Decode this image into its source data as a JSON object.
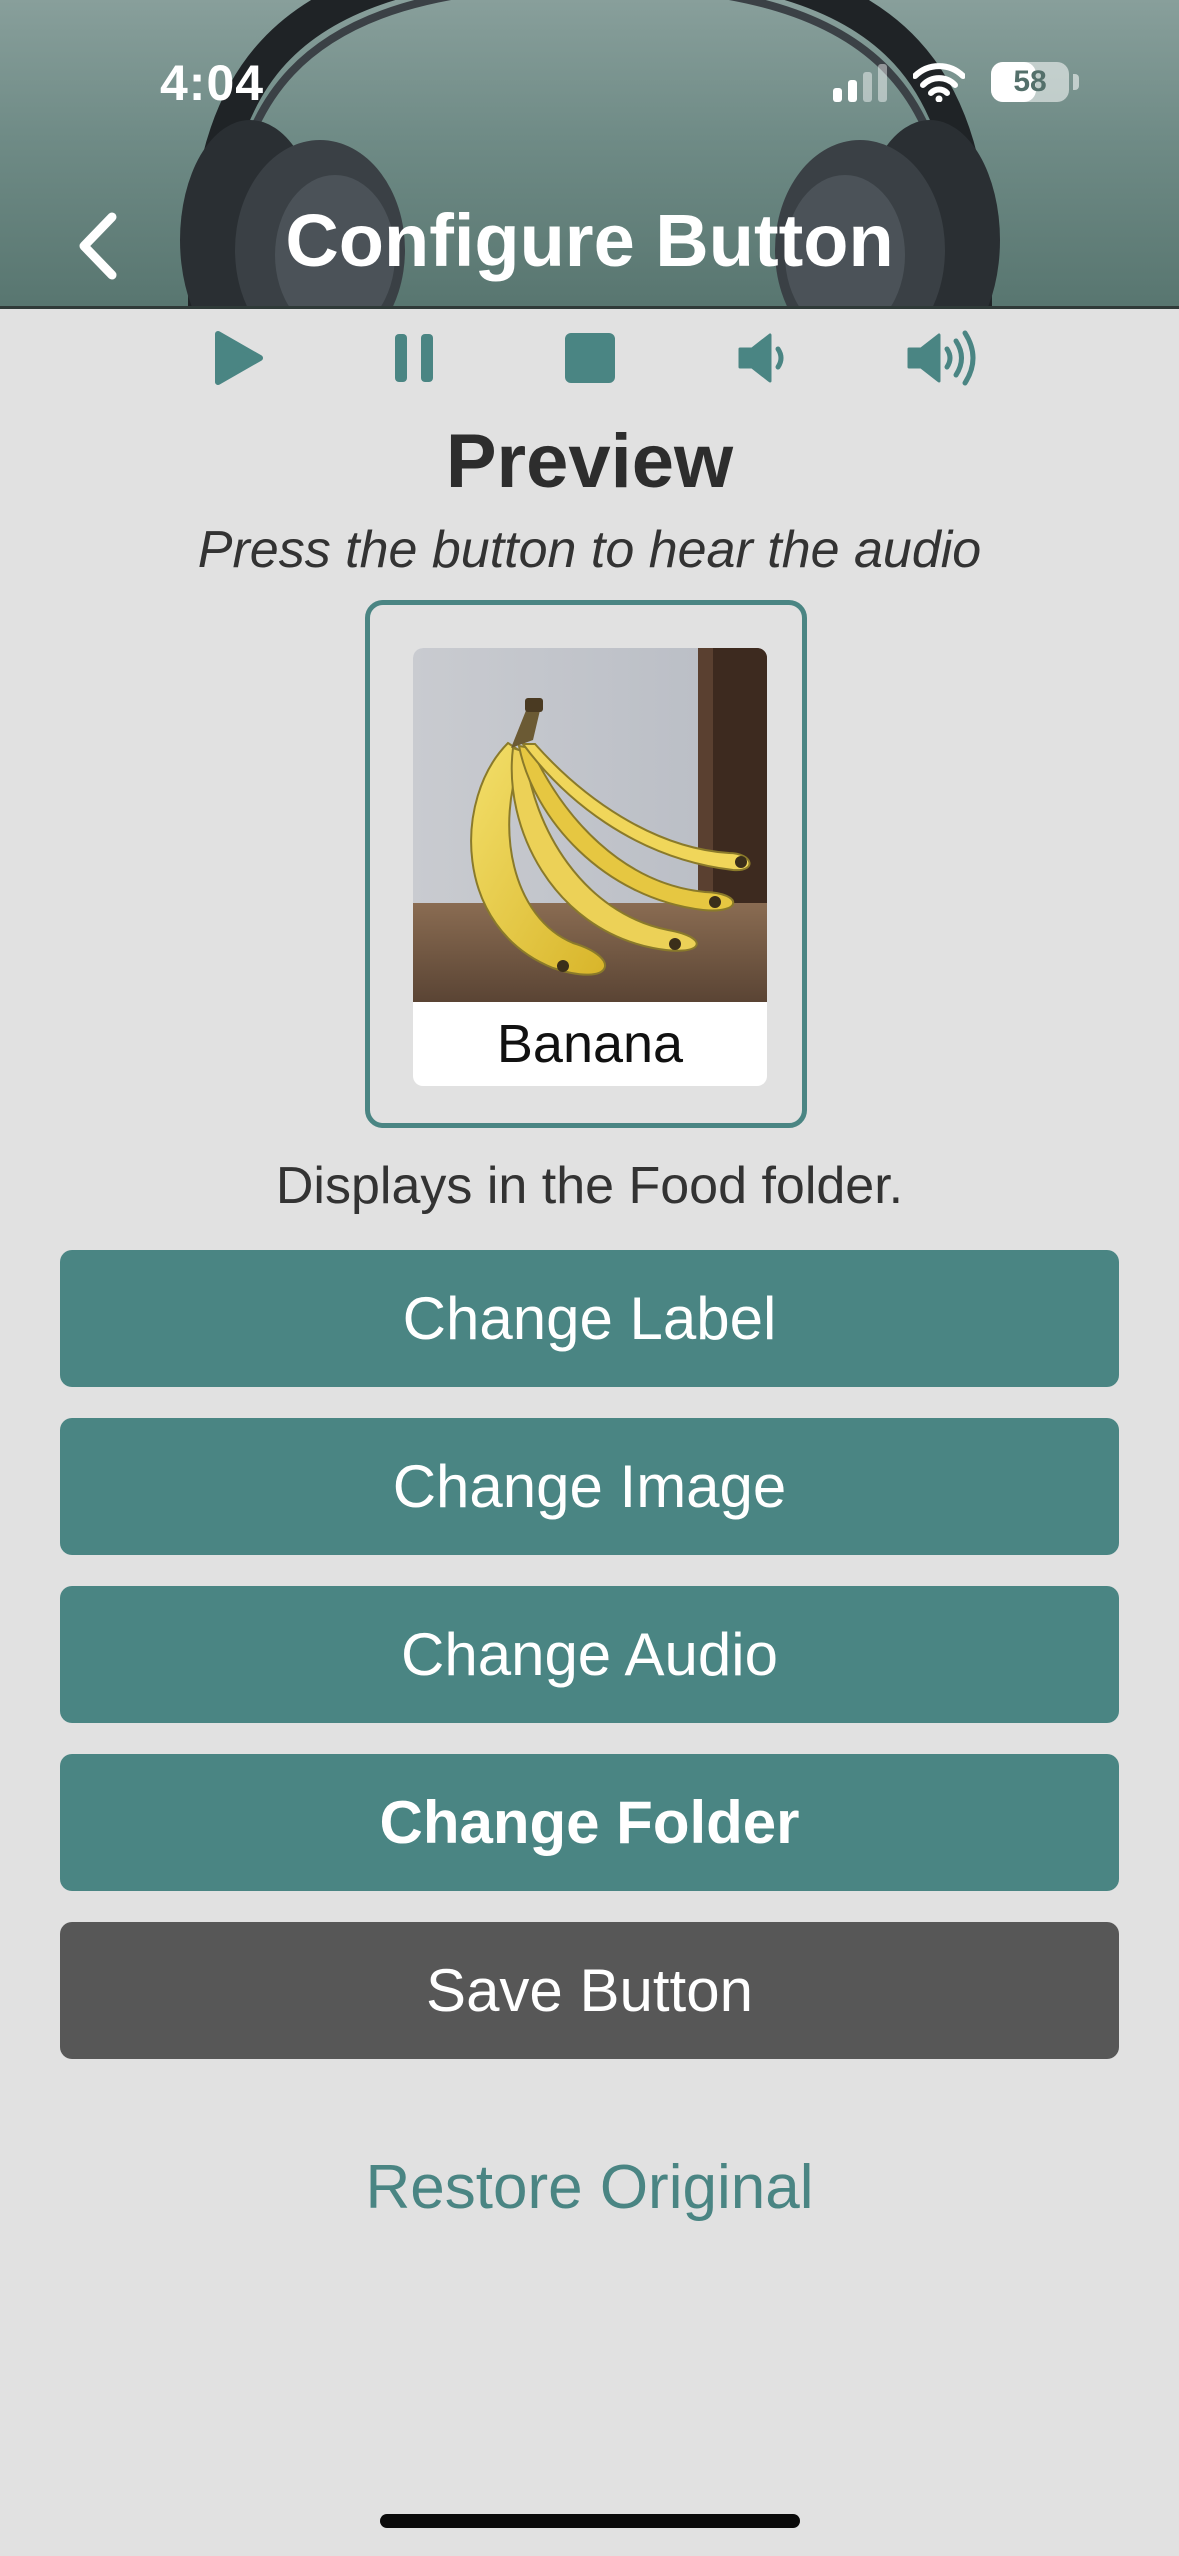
{
  "status_bar": {
    "time": "4:04",
    "battery_percent": "58",
    "battery_level": 0.58,
    "signal_bars_active": 2,
    "signal_bars_total": 4,
    "icons": [
      "signal-icon",
      "wifi-icon",
      "battery-icon"
    ]
  },
  "header": {
    "title": "Configure Button",
    "back_icon": "chevron-left-icon"
  },
  "audio_controls": {
    "items": [
      {
        "name": "play",
        "icon": "play-icon"
      },
      {
        "name": "pause",
        "icon": "pause-icon"
      },
      {
        "name": "stop",
        "icon": "stop-icon"
      },
      {
        "name": "volume-down",
        "icon": "volume-low-icon"
      },
      {
        "name": "volume-up",
        "icon": "volume-high-icon"
      }
    ]
  },
  "preview": {
    "title": "Preview",
    "subtitle": "Press the button to hear the audio",
    "card_label": "Banana",
    "folder_note": "Displays in the Food folder."
  },
  "actions": {
    "change_label": "Change Label",
    "change_image": "Change Image",
    "change_audio": "Change Audio",
    "change_folder": "Change Folder",
    "save_button": "Save Button",
    "restore_original": "Restore Original"
  },
  "colors": {
    "accent": "#4a8583",
    "save": "#575757",
    "background": "#e1e1e1",
    "header": "#6f8b86"
  }
}
